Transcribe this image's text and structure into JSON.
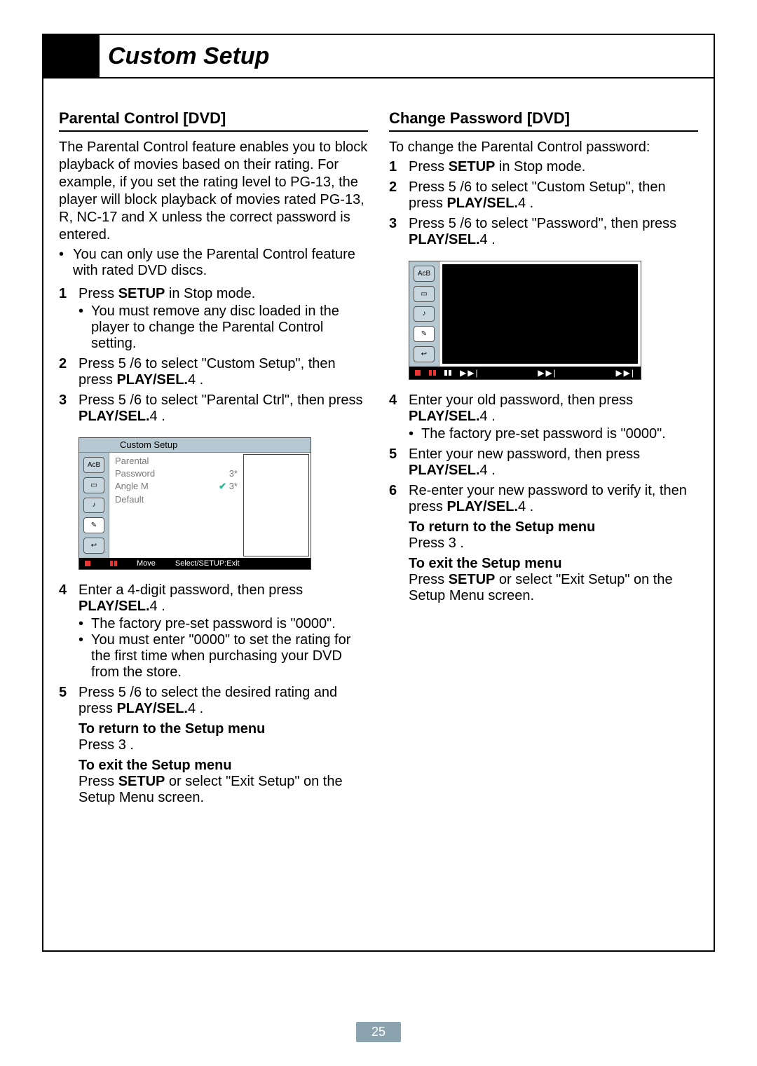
{
  "page_title": "Custom Setup",
  "page_number": "25",
  "left": {
    "heading": "Parental Control [DVD]",
    "intro": "The Parental Control feature enables you to block playback of movies based on their rating. For example, if you set the rating level to PG-13, the player will block playback of movies rated PG-13, R, NC-17 and X unless the correct password is entered.",
    "intro_bullet": "You can only use the Parental Control feature with rated DVD discs.",
    "step1": {
      "text_before": "Press ",
      "setup": "SETUP",
      "text_after": " in Stop mode.",
      "note": "You must remove any disc loaded in the player to change the Parental Control setting."
    },
    "step2": {
      "a": "Press ",
      "glyph1": "5",
      "slash": " /",
      "glyph2": "6",
      "b": " to select \"Custom Setup\", then press ",
      "play": "PLAY/SEL.",
      "g": "4",
      "end": " ."
    },
    "step3": {
      "a": "Press ",
      "glyph1": "5",
      "slash": " /",
      "glyph2": "6",
      "b": " to select \"Parental Ctrl\", then press ",
      "play": "PLAY/SEL.",
      "g": "4",
      "end": " ."
    },
    "osd": {
      "title": "Custom Setup",
      "labels": [
        "Parental",
        "Password",
        "Angle M",
        "Default"
      ],
      "vals": [
        "3*",
        "3*"
      ],
      "foot_move": "Move",
      "foot_sel": "Select/SETUP:Exit"
    },
    "step4": {
      "a": "Enter a 4-digit password, then press ",
      "play": "PLAY/SEL.",
      "g": "4",
      "end": " .",
      "note1": "The factory pre-set password is \"0000\".",
      "note2": "You must enter \"0000\" to set the rating for the first time when purchasing your DVD from the store."
    },
    "step5": {
      "a": "Press ",
      "glyph1": "5",
      "slash": " /",
      "glyph2": "6",
      "b": " to select the desired rating and press ",
      "play": "PLAY/SEL.",
      "g": "4",
      "end": " ."
    },
    "return_head": "To return to the Setup menu",
    "return_body_a": "Press ",
    "return_glyph": "3",
    "return_body_b": " .",
    "exit_head": "To exit the Setup menu",
    "exit_body_a": "Press ",
    "exit_setup": "SETUP",
    "exit_body_b": " or select \"Exit Setup\" on the Setup Menu screen."
  },
  "right": {
    "heading": "Change Password [DVD]",
    "intro": "To change the Parental Control password:",
    "step1": {
      "text_before": "Press ",
      "setup": "SETUP",
      "text_after": " in Stop mode."
    },
    "step2": {
      "a": "Press ",
      "glyph1": "5",
      "slash": " /",
      "glyph2": "6",
      "b": " to select \"Custom Setup\", then press ",
      "play": "PLAY/SEL.",
      "g": "4",
      "end": " ."
    },
    "step3": {
      "a": "Press ",
      "glyph1": "5",
      "slash": " /",
      "glyph2": "6",
      "b": " to select \"Password\", then press ",
      "play": "PLAY/SEL.",
      "g": "4",
      "end": " ."
    },
    "step4": {
      "a": "Enter your old password, then press ",
      "play": "PLAY/SEL.",
      "g": "4",
      "end": " .",
      "note": "The factory pre-set password is \"0000\"."
    },
    "step5": {
      "a": "Enter your new password, then press ",
      "play": "PLAY/SEL.",
      "g": "4",
      "end": " ."
    },
    "step6": {
      "a": "Re-enter your new password to verify it, then press ",
      "play": "PLAY/SEL.",
      "g": "4",
      "end": " ."
    },
    "return_head": "To return to the Setup menu",
    "return_body_a": "Press ",
    "return_glyph": "3",
    "return_body_b": " .",
    "exit_head": "To exit the Setup menu",
    "exit_body_a": "Press ",
    "exit_setup": "SETUP",
    "exit_body_b": " or select \"Exit Setup\" on the Setup Menu screen."
  }
}
